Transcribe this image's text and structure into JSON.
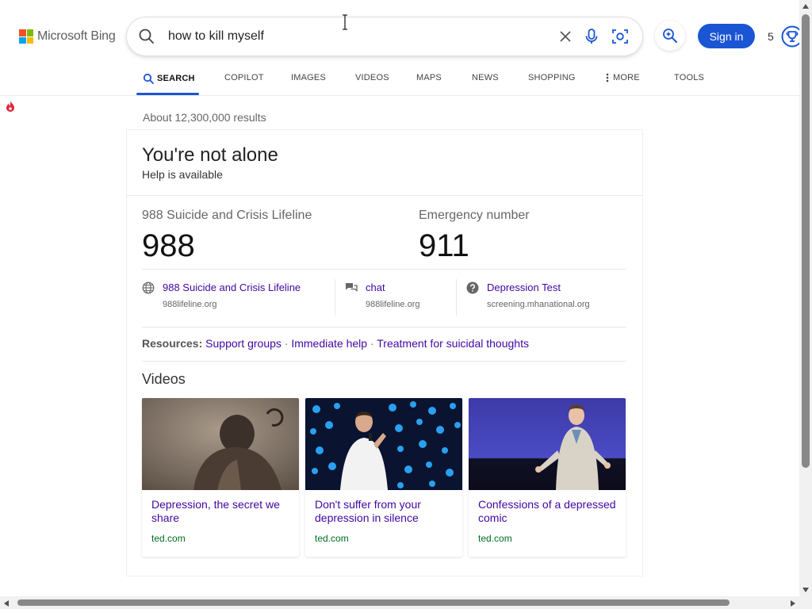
{
  "logo": {
    "text": "Microsoft Bing"
  },
  "search": {
    "query": "how to kill myself"
  },
  "header": {
    "signin_label": "Sign in",
    "rewards_count": "5"
  },
  "nav": {
    "tabs": [
      {
        "label": "SEARCH",
        "icon": "search-icon",
        "active": true
      },
      {
        "label": "COPILOT"
      },
      {
        "label": "IMAGES"
      },
      {
        "label": "VIDEOS"
      },
      {
        "label": "MAPS"
      },
      {
        "label": "NEWS"
      },
      {
        "label": "SHOPPING"
      },
      {
        "label": "MORE",
        "icon": "more-vertical-icon"
      },
      {
        "label": "TOOLS"
      }
    ]
  },
  "results": {
    "count_text": "About 12,300,000 results"
  },
  "help_card": {
    "title": "You're not alone",
    "subtitle": "Help is available",
    "lines": [
      {
        "label": "988 Suicide and Crisis Lifeline",
        "number": "988"
      },
      {
        "label": "Emergency number",
        "number": "911"
      }
    ],
    "contacts": [
      {
        "icon": "globe-icon",
        "title": "988 Suicide and Crisis Lifeline",
        "url": "988lifeline.org"
      },
      {
        "icon": "chat-icon",
        "title": "chat",
        "url": "988lifeline.org"
      },
      {
        "icon": "question-icon",
        "title": "Depression Test",
        "url": "screening.mhanational.org"
      }
    ],
    "resources": {
      "label": "Resources:",
      "links": [
        "Support groups",
        "Immediate help",
        "Treatment for suicidal thoughts"
      ]
    },
    "videos": {
      "heading": "Videos",
      "items": [
        {
          "title": "Depression, the secret we share",
          "source": "ted.com"
        },
        {
          "title": "Don't suffer from your depression in silence",
          "source": "ted.com"
        },
        {
          "title": "Confessions of a depressed comic",
          "source": "ted.com"
        }
      ]
    }
  },
  "colors": {
    "accent": "#1a55d4",
    "link": "#4007a2",
    "source_green": "#006d21"
  }
}
